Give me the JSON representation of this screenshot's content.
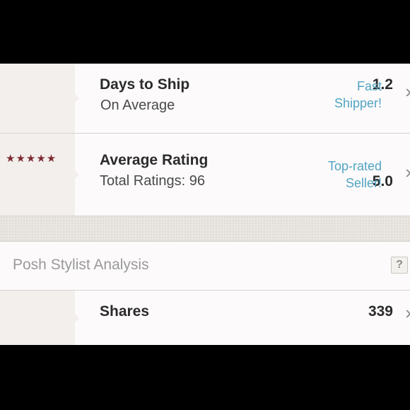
{
  "ship": {
    "value": "1.2",
    "title": "Days to Ship",
    "subtitle": "On Average",
    "badge_line1": "Fast",
    "badge_line2": "Shipper!"
  },
  "rating": {
    "stars": "★★★★★",
    "value": "5.0",
    "title": "Average Rating",
    "subtitle": "Total Ratings: 96",
    "badge_line1": "Top-rated",
    "badge_line2": "Seller!"
  },
  "analysis": {
    "title": "Posh Stylist Analysis",
    "help_label": "?"
  },
  "shares": {
    "value": "339",
    "title": "Shares"
  },
  "chevron": "›",
  "colors": {
    "accent": "#52a4c4",
    "star": "#7e2b33",
    "left_column": "#f2efec"
  }
}
